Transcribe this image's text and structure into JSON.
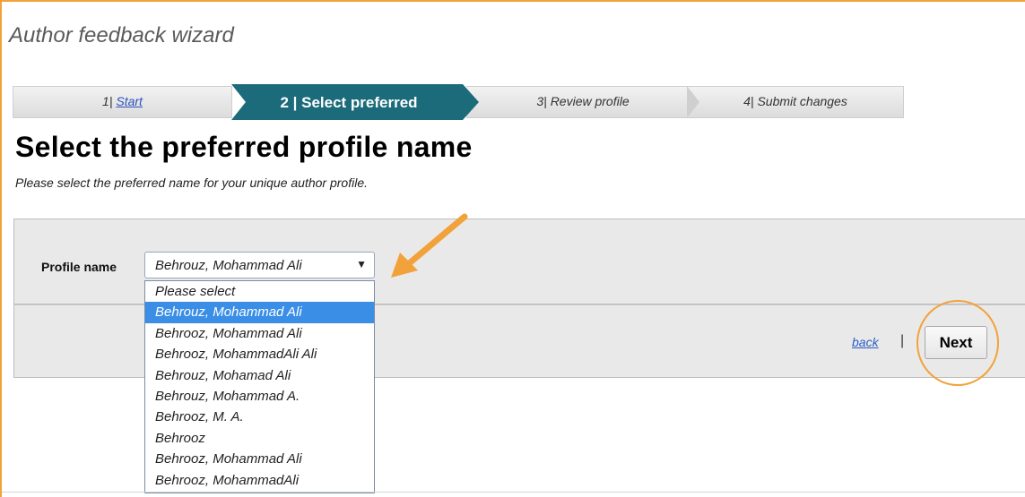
{
  "wizard": {
    "title": "Author feedback wizard"
  },
  "steps": [
    {
      "num": "1",
      "label": "Start"
    },
    {
      "num": "2",
      "label": "Select preferred"
    },
    {
      "num": "3",
      "label": "Review profile"
    },
    {
      "num": "4",
      "label": "Submit changes"
    }
  ],
  "page": {
    "heading": "Select the preferred profile name",
    "subheading": "Please select the preferred name for your unique author profile."
  },
  "form": {
    "field_label": "Profile name",
    "selected_value": "Behrouz, Mohammad Ali",
    "options": [
      "Please select",
      "Behrouz, Mohammad Ali",
      "Behrooz, Mohammad Ali",
      "Behrooz, MohammadAli Ali",
      "Behrouz, Mohamad Ali",
      "Behrouz, Mohammad A.",
      "Behrooz, M. A.",
      "Behrooz",
      "Behrooz, Mohammad Ali",
      "Behrooz, MohammadAli"
    ],
    "highlighted_index": 1
  },
  "actions": {
    "back_label": "back",
    "separator": "|",
    "next_label": "Next"
  },
  "colors": {
    "accent": "#f2a23a",
    "step_active": "#1b6b7a",
    "selection": "#3a8ee6"
  },
  "icons": {
    "select_caret": "caret-down-icon",
    "annotation_arrow": "arrow-icon"
  }
}
